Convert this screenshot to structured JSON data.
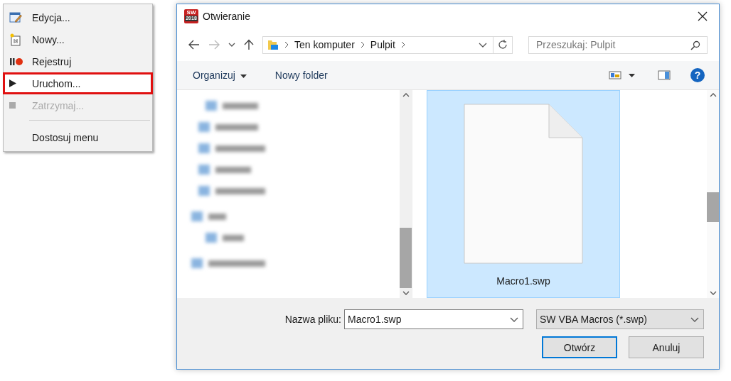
{
  "context_menu": {
    "items": [
      {
        "kind": "edit",
        "label": "Edycja...",
        "disabled": false,
        "highlighted": false
      },
      {
        "kind": "new",
        "label": "Nowy...",
        "disabled": false,
        "highlighted": false
      },
      {
        "kind": "record",
        "label": "Rejestruj",
        "disabled": false,
        "highlighted": false
      },
      {
        "kind": "run",
        "label": "Uruchom...",
        "disabled": false,
        "highlighted": true
      },
      {
        "kind": "stop",
        "label": "Zatrzymaj...",
        "disabled": true,
        "highlighted": false
      },
      {
        "kind": "separator"
      },
      {
        "kind": "plain",
        "label": "Dostosuj menu",
        "disabled": false,
        "highlighted": false
      }
    ]
  },
  "dialog": {
    "title": "Otwieranie",
    "app_badge": "SW\n2018",
    "breadcrumb": [
      "Ten komputer",
      "Pulpit"
    ],
    "search": {
      "placeholder": "Przeszukaj: Pulpit"
    },
    "toolbar": {
      "organize": "Organizuj",
      "new_folder": "Nowy folder",
      "help": "?"
    },
    "files": [
      {
        "name": "Macro1.swp",
        "selected": true
      }
    ],
    "file_name_label": "Nazwa pliku:",
    "file_name_value": "Macro1.swp",
    "file_type": "SW VBA Macros (*.swp)",
    "buttons": [
      {
        "label": "Otwórz",
        "default": true
      },
      {
        "label": "Anuluj",
        "default": false
      }
    ]
  }
}
